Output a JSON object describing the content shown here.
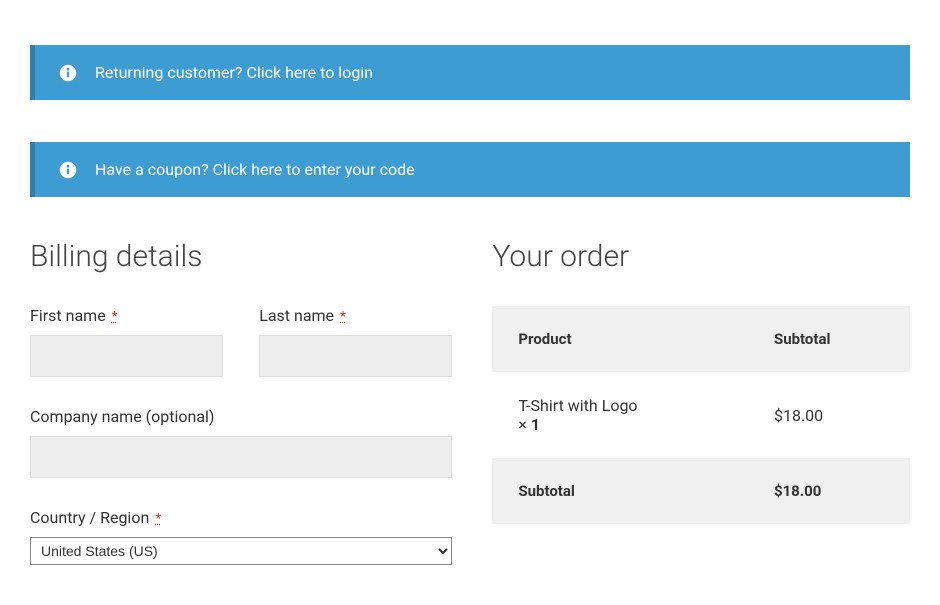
{
  "notices": {
    "login": "Returning customer? Click here to login",
    "coupon": "Have a coupon? Click here to enter your code"
  },
  "billing": {
    "heading": "Billing details",
    "first_name_label": "First name",
    "last_name_label": "Last name",
    "company_label": "Company name (optional)",
    "country_label": "Country / Region",
    "country_value": "United States (US)",
    "required_mark": "*"
  },
  "order": {
    "heading": "Your order",
    "product_header": "Product",
    "subtotal_header": "Subtotal",
    "items": [
      {
        "name": "T-Shirt with Logo",
        "qty": "1",
        "price": "$18.00"
      }
    ],
    "subtotal_label": "Subtotal",
    "subtotal_value": "$18.00",
    "qty_prefix": "× "
  }
}
